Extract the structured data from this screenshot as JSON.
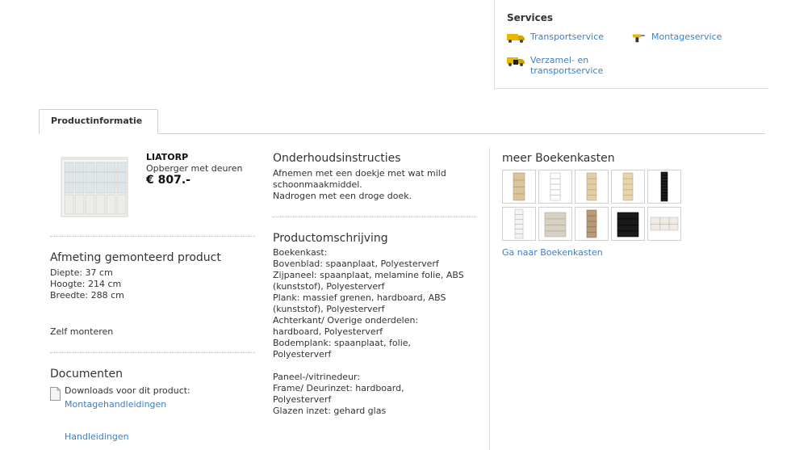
{
  "services": {
    "title": "Services",
    "items": [
      {
        "label": "Transportservice",
        "icon": "truck-icon"
      },
      {
        "label": "Montageservice",
        "icon": "drill-icon"
      },
      {
        "label": "Verzamel- en transportservice",
        "icon": "truck-box-icon"
      }
    ]
  },
  "tabs": [
    {
      "label": "Productinformatie",
      "active": true
    }
  ],
  "product": {
    "name": "LIATORP",
    "description": "Opberger met deuren",
    "price": "€ 807.-"
  },
  "dimensions": {
    "heading": "Afmeting gemonteerd product",
    "lines": [
      "Diepte: 37 cm",
      "Hoogte: 214 cm",
      "Breedte: 288 cm"
    ],
    "assembly": "Zelf monteren"
  },
  "documents": {
    "heading": "Documenten",
    "downloads_label": "Downloads voor dit product:",
    "link_manuals": "Montagehandleidingen",
    "link_guides": "Handleidingen"
  },
  "care": {
    "heading": "Onderhoudsinstructies",
    "text": "Afnemen met een doekje met wat mild\nschoonmaakmiddel.\nNadrogen met een droge doek."
  },
  "description": {
    "heading": "Productomschrijving",
    "text": "Boekenkast:\nBovenblad: spaanplaat, Polyesterverf\nZijpaneel: spaanplaat, melamine folie, ABS\n(kunststof), Polyesterverf\nPlank: massief grenen, hardboard, ABS\n(kunststof), Polyesterverf\nAchterkant/ Overige onderdelen:\nhardboard, Polyesterverf\nBodemplank: spaanplaat, folie,\nPolyesterverf\n\nPaneel-/vitrinedeur:\nFrame/ Deurinzet: hardboard,\nPolyesterverf\nGlazen inzet: gehard glas"
  },
  "related": {
    "heading": "meer Boekenkasten",
    "link": "Ga naar Boekenkasten",
    "thumbnails": [
      {
        "kind": "ladder",
        "color": "#d9c49b"
      },
      {
        "kind": "narrow",
        "color": "#ffffff"
      },
      {
        "kind": "narrow",
        "color": "#e2cfa8"
      },
      {
        "kind": "narrow",
        "color": "#e6d4ae"
      },
      {
        "kind": "cd-tall",
        "color": "#1e1e1e"
      },
      {
        "kind": "narrow-tall",
        "color": "#f3f3f3"
      },
      {
        "kind": "wide",
        "color": "#d8d0c2"
      },
      {
        "kind": "narrow",
        "color": "#b89a7a"
      },
      {
        "kind": "wide",
        "color": "#1a1a1a"
      },
      {
        "kind": "low",
        "color": "#efebe2"
      }
    ]
  },
  "colors": {
    "link": "#3d7fc4",
    "text": "#333333",
    "border": "#cfcfcf",
    "truck": "#e8b800"
  }
}
